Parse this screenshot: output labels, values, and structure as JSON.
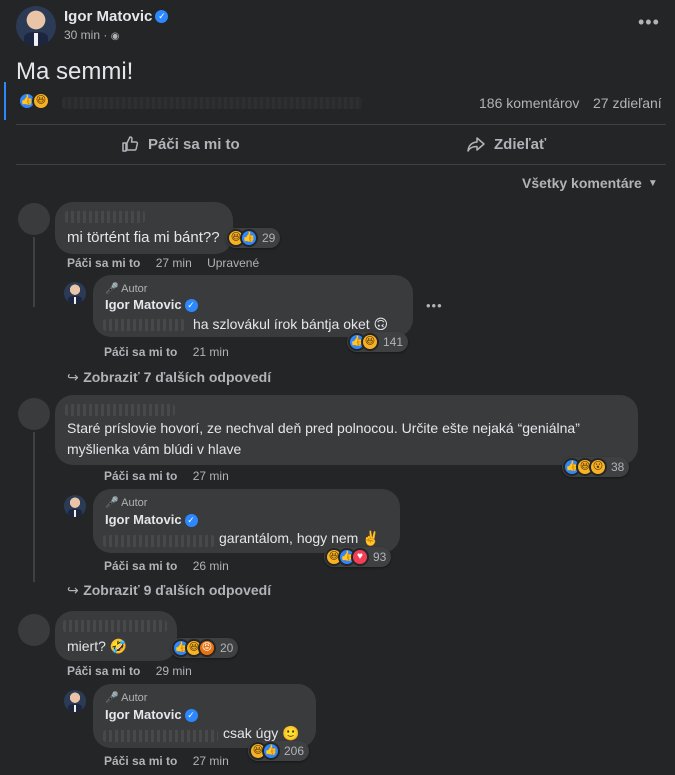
{
  "post": {
    "author": "Igor Matovic",
    "time": "30 min",
    "globe": "🌐",
    "text": "Ma semmi!",
    "comments_count": "186 komentárov",
    "shares_count": "27 zdieľaní",
    "actions": {
      "like": "Páči sa mi to",
      "share": "Zdieľať"
    },
    "sort_label": "Všetky komentáre"
  },
  "comments": [
    {
      "text": "mi történt fia mi bánt??",
      "reactions": "29",
      "like": "Páči sa mi to",
      "time": "27 min",
      "edited": "Upravené",
      "reply": {
        "author_tag": "Autor",
        "author": "Igor Matovic",
        "text": "ha szlovákul írok bántja oket 🙃",
        "reactions": "141",
        "like": "Páči sa mi to",
        "time": "21 min"
      },
      "more_replies": "Zobraziť 7 ďalších odpovedí"
    },
    {
      "text1": "Staré príslovie hovorí, ze nechval deň pred polnocou. Určite ešte nejaká “geniálna”",
      "text2": "myšlienka vám blúdi v hlave",
      "reactions": "38",
      "like": "Páči sa mi to",
      "time": "27 min",
      "reply": {
        "author_tag": "Autor",
        "author": "Igor Matovic",
        "text": "garantálom, hogy nem ✌️",
        "reactions": "93",
        "like": "Páči sa mi to",
        "time": "26 min"
      },
      "more_replies": "Zobraziť 9 ďalších odpovedí"
    },
    {
      "text": "miert? 🤣",
      "reactions": "20",
      "like": "Páči sa mi to",
      "time": "29 min",
      "reply": {
        "author_tag": "Autor",
        "author": "Igor Matovic",
        "text": "csak úgy 🙂",
        "reactions": "206",
        "like": "Páči sa mi to",
        "time": "27 min"
      }
    }
  ],
  "colors": {
    "background": "#242526",
    "bubble": "#3a3b3c",
    "accent": "#2d88ff"
  }
}
